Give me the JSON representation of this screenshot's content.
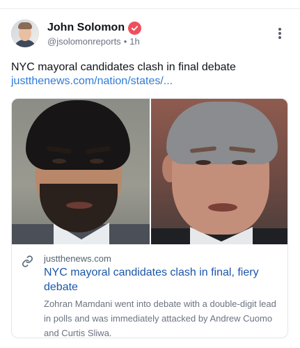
{
  "author": {
    "name": "John Solomon",
    "handle": "@jsolomonreports",
    "time": "1h",
    "separator": "•"
  },
  "post": {
    "text": "NYC mayoral candidates clash in final debate",
    "link": "justthenews.com/nation/states/..."
  },
  "card": {
    "domain": "justthenews.com",
    "title": "NYC mayoral candidates clash in final, fiery debate",
    "description": "Zohran Mamdani went into debate with a double-digit lead in polls and was immediately attacked by Andrew Cuomo and Curtis Sliwa."
  },
  "colors": {
    "verified_badge": "#ee4f5c",
    "link": "#2f7bd6",
    "card_title": "#1a56a8"
  },
  "icons": {
    "verified": "verified-badge-icon",
    "more": "more-vertical-icon",
    "link": "link-icon"
  }
}
